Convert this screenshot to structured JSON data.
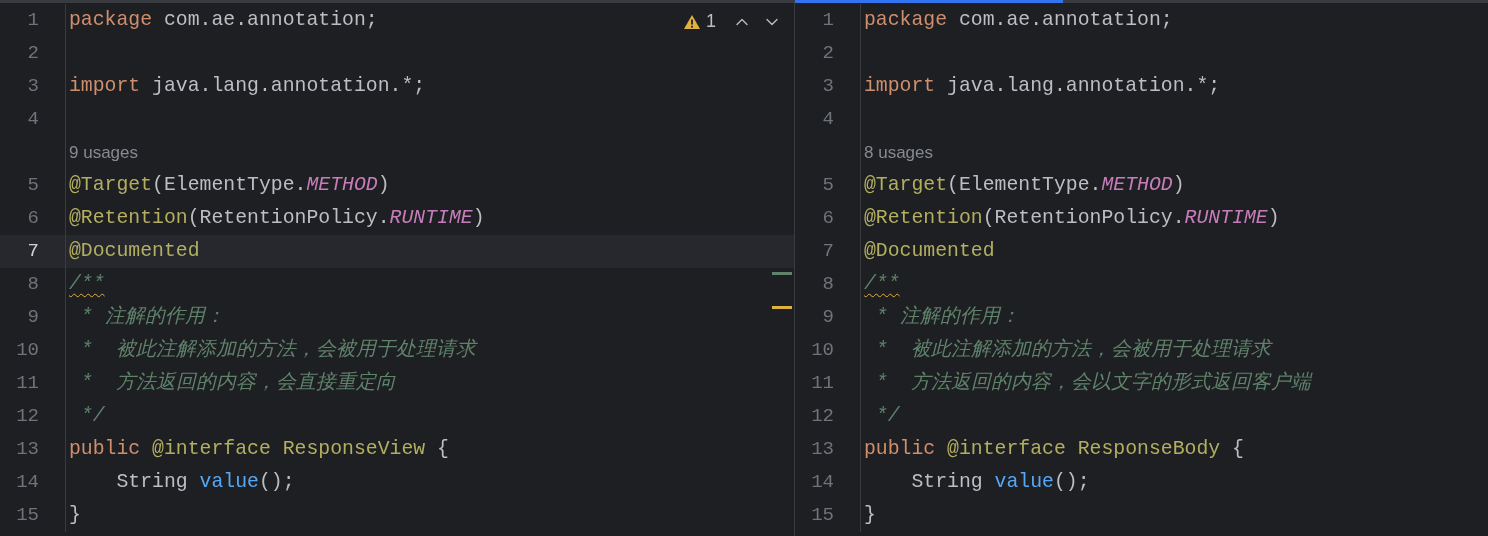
{
  "panes": [
    {
      "focused": false,
      "inspection": {
        "warnings": "1"
      },
      "lines": [
        {
          "kind": "code",
          "number": "1",
          "current": false,
          "tokens": [
            {
              "kind": "keyword",
              "text": "package"
            },
            {
              "kind": "plain",
              "text": " com.ae.annotation;"
            }
          ]
        },
        {
          "kind": "code",
          "number": "2",
          "current": false
        },
        {
          "kind": "code",
          "number": "3",
          "current": false,
          "tokens": [
            {
              "kind": "keyword",
              "text": "import"
            },
            {
              "kind": "plain",
              "text": " java.lang.annotation.*;"
            }
          ]
        },
        {
          "kind": "code",
          "number": "4",
          "current": false
        },
        {
          "kind": "hint",
          "text": "9 usages"
        },
        {
          "kind": "code",
          "number": "5",
          "current": false,
          "tokens": [
            {
              "kind": "annotation",
              "text": "@Target"
            },
            {
              "kind": "plain",
              "text": "(ElementType."
            },
            {
              "kind": "constant",
              "text": "METHOD"
            },
            {
              "kind": "plain",
              "text": ")"
            }
          ]
        },
        {
          "kind": "code",
          "number": "6",
          "current": false,
          "tokens": [
            {
              "kind": "annotation",
              "text": "@Retention"
            },
            {
              "kind": "plain",
              "text": "(RetentionPolicy."
            },
            {
              "kind": "constant",
              "text": "RUNTIME"
            },
            {
              "kind": "plain",
              "text": ")"
            }
          ]
        },
        {
          "kind": "code",
          "number": "7",
          "current": true,
          "tokens": [
            {
              "kind": "annotation",
              "text": "@Documented"
            }
          ]
        },
        {
          "kind": "code",
          "number": "8",
          "current": false,
          "tokens": [
            {
              "kind": "doc-open",
              "text": "/**"
            }
          ]
        },
        {
          "kind": "code",
          "number": "9",
          "current": false,
          "tokens": [
            {
              "kind": "comment",
              "text": " * 注解的作用："
            }
          ]
        },
        {
          "kind": "code",
          "number": "10",
          "current": false,
          "tokens": [
            {
              "kind": "comment",
              "text": " *  被此注解添加的方法，会被用于处理请求"
            }
          ]
        },
        {
          "kind": "code",
          "number": "11",
          "current": false,
          "tokens": [
            {
              "kind": "comment",
              "text": " *  方法返回的内容，会直接重定向"
            }
          ]
        },
        {
          "kind": "code",
          "number": "12",
          "current": false,
          "tokens": [
            {
              "kind": "comment",
              "text": " */"
            }
          ]
        },
        {
          "kind": "code",
          "number": "13",
          "current": false,
          "tokens": [
            {
              "kind": "keyword",
              "text": "public "
            },
            {
              "kind": "annotation",
              "text": "@interface "
            },
            {
              "kind": "type",
              "text": "ResponseView"
            },
            {
              "kind": "plain",
              "text": " {"
            }
          ]
        },
        {
          "kind": "code",
          "number": "14",
          "current": false,
          "tokens": [
            {
              "kind": "plain",
              "text": "    String "
            },
            {
              "kind": "method",
              "text": "value"
            },
            {
              "kind": "plain",
              "text": "();"
            }
          ]
        },
        {
          "kind": "code",
          "number": "15",
          "current": false,
          "tokens": [
            {
              "kind": "plain",
              "text": "}"
            }
          ]
        }
      ]
    },
    {
      "focused": true,
      "lines": [
        {
          "kind": "code",
          "number": "1",
          "current": false,
          "tokens": [
            {
              "kind": "keyword",
              "text": "package"
            },
            {
              "kind": "plain",
              "text": " com.ae.annotation;"
            }
          ]
        },
        {
          "kind": "code",
          "number": "2",
          "current": false
        },
        {
          "kind": "code",
          "number": "3",
          "current": false,
          "tokens": [
            {
              "kind": "keyword",
              "text": "import"
            },
            {
              "kind": "plain",
              "text": " java.lang.annotation.*;"
            }
          ]
        },
        {
          "kind": "code",
          "number": "4",
          "current": false
        },
        {
          "kind": "hint",
          "text": "8 usages"
        },
        {
          "kind": "code",
          "number": "5",
          "current": false,
          "tokens": [
            {
              "kind": "annotation",
              "text": "@Target"
            },
            {
              "kind": "plain",
              "text": "(ElementType."
            },
            {
              "kind": "constant",
              "text": "METHOD"
            },
            {
              "kind": "plain",
              "text": ")"
            }
          ]
        },
        {
          "kind": "code",
          "number": "6",
          "current": false,
          "tokens": [
            {
              "kind": "annotation",
              "text": "@Retention"
            },
            {
              "kind": "plain",
              "text": "(RetentionPolicy."
            },
            {
              "kind": "constant",
              "text": "RUNTIME"
            },
            {
              "kind": "plain",
              "text": ")"
            }
          ]
        },
        {
          "kind": "code",
          "number": "7",
          "current": false,
          "tokens": [
            {
              "kind": "annotation",
              "text": "@Documented"
            }
          ]
        },
        {
          "kind": "code",
          "number": "8",
          "current": false,
          "tokens": [
            {
              "kind": "doc-open",
              "text": "/**"
            }
          ]
        },
        {
          "kind": "code",
          "number": "9",
          "current": false,
          "tokens": [
            {
              "kind": "comment",
              "text": " * 注解的作用："
            }
          ]
        },
        {
          "kind": "code",
          "number": "10",
          "current": false,
          "tokens": [
            {
              "kind": "comment",
              "text": " *  被此注解添加的方法，会被用于处理请求"
            }
          ]
        },
        {
          "kind": "code",
          "number": "11",
          "current": false,
          "tokens": [
            {
              "kind": "comment",
              "text": " *  方法返回的内容，会以文字的形式返回客户端"
            }
          ]
        },
        {
          "kind": "code",
          "number": "12",
          "current": false,
          "tokens": [
            {
              "kind": "comment",
              "text": " */"
            }
          ]
        },
        {
          "kind": "code",
          "number": "13",
          "current": false,
          "tokens": [
            {
              "kind": "keyword",
              "text": "public "
            },
            {
              "kind": "annotation",
              "text": "@interface "
            },
            {
              "kind": "type",
              "text": "ResponseBody"
            },
            {
              "kind": "plain",
              "text": " {"
            }
          ]
        },
        {
          "kind": "code",
          "number": "14",
          "current": false,
          "tokens": [
            {
              "kind": "plain",
              "text": "    String "
            },
            {
              "kind": "method",
              "text": "value"
            },
            {
              "kind": "plain",
              "text": "();"
            }
          ]
        },
        {
          "kind": "code",
          "number": "15",
          "current": false,
          "tokens": [
            {
              "kind": "plain",
              "text": "}"
            }
          ]
        }
      ]
    }
  ]
}
